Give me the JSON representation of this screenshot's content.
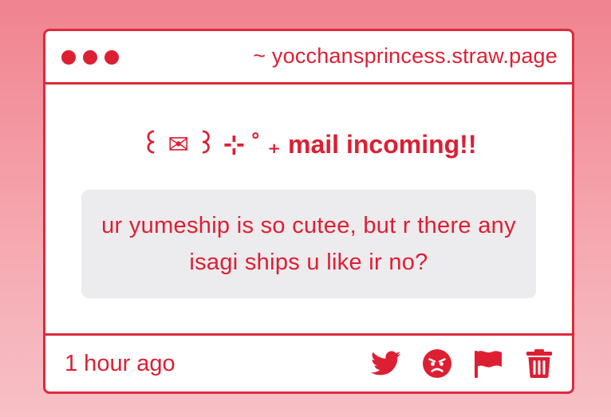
{
  "titlebar": {
    "url": "~ yocchansprincess.straw.page"
  },
  "content": {
    "heading": "꒰ ✉ ꒱ ⊹ ˚ ₊ mail incoming!!",
    "message": "ur yumeship is so cutee, but r there any isagi ships u like ir no?"
  },
  "footer": {
    "timestamp": "1 hour ago",
    "actions": [
      "twitter-icon",
      "angry-face-icon",
      "flag-icon",
      "trash-icon"
    ]
  },
  "colors": {
    "accent": "#dd1f33",
    "message_bg": "#ecebed",
    "background_top": "#f0838f",
    "background_bottom": "#f7c0c6"
  }
}
